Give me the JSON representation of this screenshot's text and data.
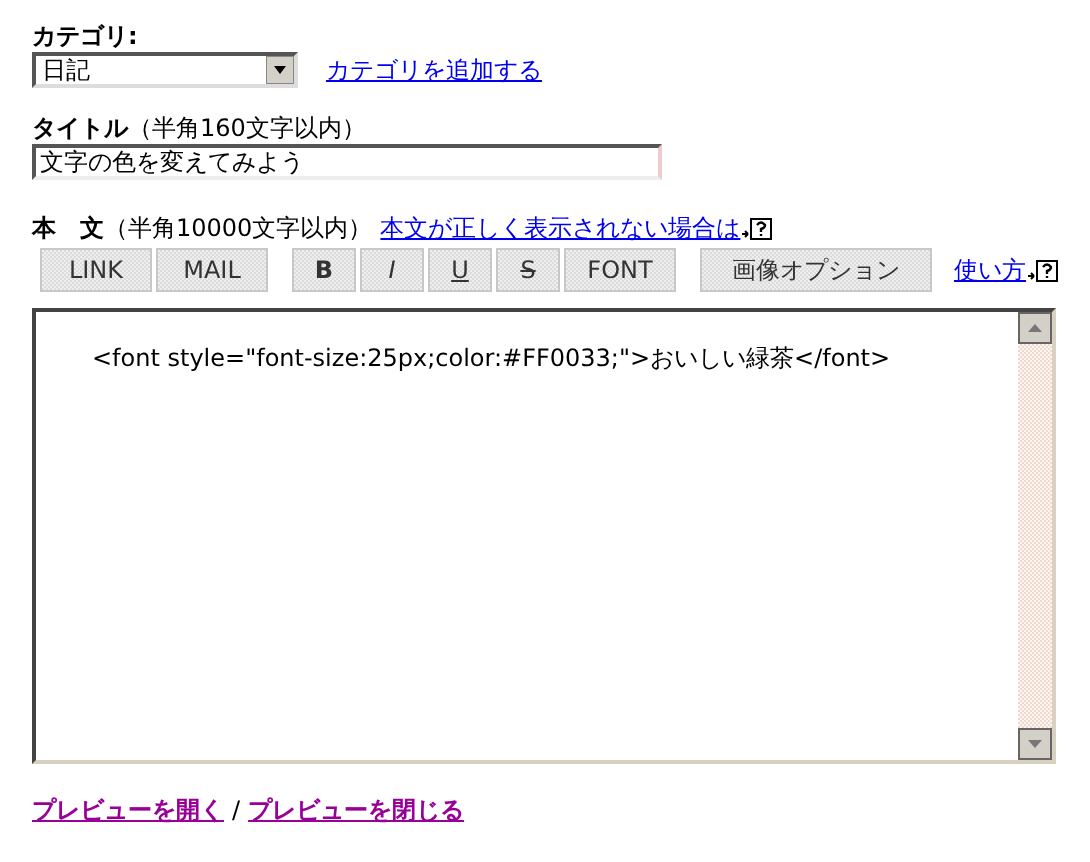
{
  "category": {
    "label": "カテゴリ:",
    "value": "日記",
    "add_link": "カテゴリを追加する"
  },
  "title": {
    "label": "**タイトル**（半角160文字以内）",
    "value": "文字の色を変えてみよう"
  },
  "body": {
    "label": "**本　文**（半角10000文字以内）",
    "help_link": "本文が正しく表示されない場合は",
    "toolbar": [
      [
        {
          "label": "LINK",
          "kind": "plain"
        },
        {
          "label": "MAIL",
          "kind": "plain"
        }
      ],
      [
        {
          "label": "B",
          "kind": "bold"
        },
        {
          "label": "I",
          "kind": "italic"
        },
        {
          "label": "U",
          "kind": "underline"
        },
        {
          "label": "S",
          "kind": "strike"
        },
        {
          "label": "FONT",
          "kind": "plain"
        }
      ],
      [
        {
          "label": "画像オプション",
          "kind": "wide"
        }
      ]
    ],
    "usage_link": "使い方",
    "value": "<font style=\"font-size:25px;color:#FF0033;\">おいしい緑茶</font>"
  },
  "preview": {
    "open": "プレビューを開く",
    "separator": "/",
    "close": "プレビューを閉じる"
  }
}
